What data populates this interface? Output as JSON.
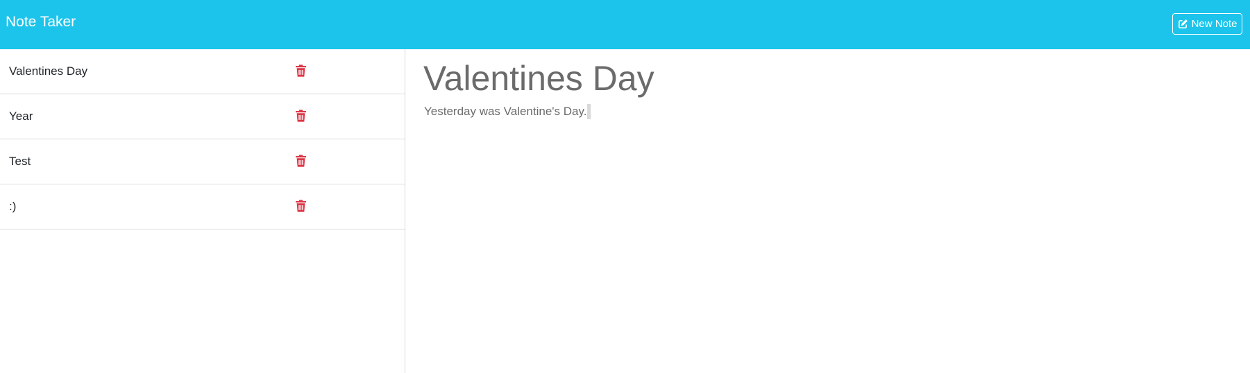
{
  "navbar": {
    "brand": "Note Taker",
    "new_note_label": "New Note",
    "new_note_icon": "pencil-square-icon"
  },
  "sidebar": {
    "notes": [
      {
        "title": "Valentines Day",
        "delete_icon": "trash-icon"
      },
      {
        "title": "Year",
        "delete_icon": "trash-icon"
      },
      {
        "title": "Test",
        "delete_icon": "trash-icon"
      },
      {
        "title": ":)",
        "delete_icon": "trash-icon"
      }
    ]
  },
  "active_note": {
    "title": "Valentines Day",
    "text": "Yesterday was Valentine's Day."
  },
  "colors": {
    "navbar": "#1cc4eb",
    "delete": "#dc3545",
    "note_text": "#6b6b6b"
  }
}
